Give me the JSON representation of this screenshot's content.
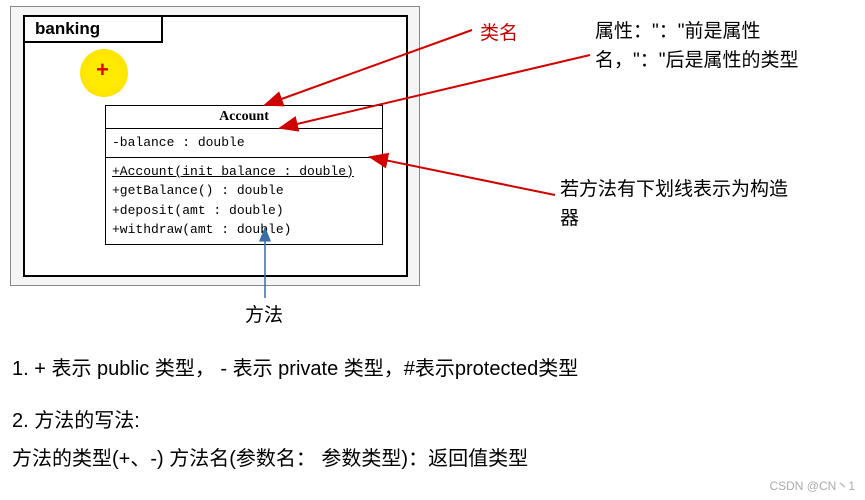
{
  "uml": {
    "package_name": "banking",
    "plus": "+",
    "class_name": "Account",
    "attribute": "-balance : double",
    "methods": {
      "constructor": "+Account(init_balance : double)",
      "m1": "+getBalance() : double",
      "m2": "+deposit(amt : double)",
      "m3": "+withdraw(amt : double)"
    }
  },
  "annotations": {
    "classname": "类名",
    "attribute": "属性：\"：\"前是属性名，\"：\"后是属性的类型",
    "constructor": "若方法有下划线表示为构造器",
    "method": "方法"
  },
  "explanation": {
    "line1": "1. + 表示 public 类型， - 表示 private 类型，#表示protected类型",
    "line2": "2. 方法的写法:",
    "line3": "方法的类型(+、-)  方法名(参数名： 参数类型)：返回值类型"
  },
  "watermark": "CSDN @CN丶1"
}
